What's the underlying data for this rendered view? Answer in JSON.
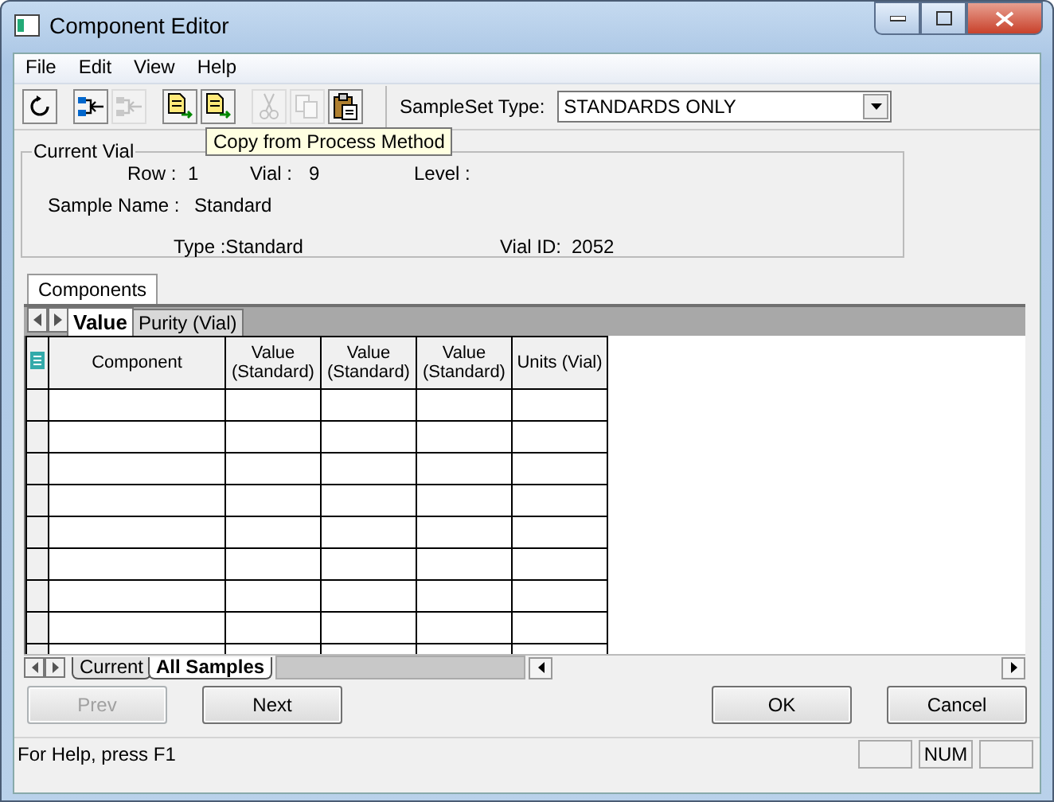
{
  "window": {
    "title": "Component Editor"
  },
  "menu": [
    "File",
    "Edit",
    "View",
    "Help"
  ],
  "toolbar": [
    {
      "kind": "refresh",
      "disabled": false
    },
    {
      "kind": "link",
      "disabled": false
    },
    {
      "kind": "link",
      "disabled": true
    },
    {
      "kind": "copy-in",
      "disabled": false
    },
    {
      "kind": "copy-in",
      "disabled": false
    },
    {
      "kind": "cut",
      "disabled": true
    },
    {
      "kind": "copy",
      "disabled": true
    },
    {
      "kind": "paste",
      "disabled": false
    }
  ],
  "sampleset_type": {
    "label": "SampleSet Type:",
    "value": "STANDARDS ONLY"
  },
  "tooltip": "Copy from Process Method",
  "current_vial": {
    "title": "Current Vial",
    "row_label": "Row :",
    "row": "1",
    "vial_label": "Vial :",
    "vial": "9",
    "level_label": "Level :",
    "sample_name_label": "Sample Name :",
    "sample_name": "Standard",
    "type": "Type :Standard",
    "vial_id_label": "Vial ID:",
    "vial_id": "2052"
  },
  "outer_tabs": [
    {
      "label": "Components",
      "selected": true
    }
  ],
  "inner_tabs": [
    {
      "label": "Value",
      "selected": true
    },
    {
      "label": "Purity (Vial)",
      "selected": false
    }
  ],
  "table": {
    "columns": [
      "Component",
      "Value (Standard)",
      "Value (Standard)",
      "Value (Standard)",
      "Units (Vial)"
    ]
  },
  "sheet_tabs": [
    {
      "label": "Current",
      "selected": false
    },
    {
      "label": "All Samples",
      "selected": true
    }
  ],
  "buttons": [
    {
      "label": "Prev",
      "disabled": true
    },
    {
      "label": "Next",
      "disabled": false
    },
    {
      "label": "OK",
      "disabled": false
    },
    {
      "label": "Cancel",
      "disabled": false
    }
  ],
  "status_bar": {
    "text": "For Help, press F1",
    "indicators": [
      "NUM"
    ]
  }
}
